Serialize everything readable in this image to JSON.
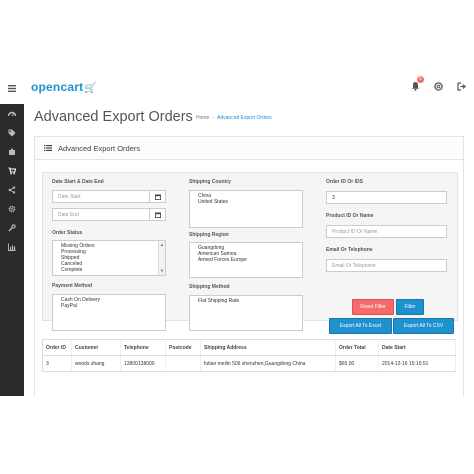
{
  "topbar": {
    "logo_text": "opencart",
    "logo_cart": "🛒",
    "alert_count": "6"
  },
  "page": {
    "title": "Advanced Export Orders",
    "breadcrumbs": [
      "Home",
      "Advanced Export Orders"
    ],
    "panel_title": "Advanced Export Orders"
  },
  "filters": {
    "date_label": "Date Start & Date End",
    "date_start_placeholder": "Date Start",
    "date_end_placeholder": "Date End",
    "order_status_label": "Order Status",
    "order_statuses": [
      "Missing Orders",
      "Processing",
      "Shipped",
      "Canceled",
      "Complete"
    ],
    "payment_method_label": "Payment Method",
    "payment_methods": [
      "Cash On Delivery",
      "PayPal"
    ],
    "shipping_country_label": "Shipping Country",
    "shipping_countries": [
      "China",
      "United States"
    ],
    "shipping_region_label": "Shipping Region",
    "shipping_regions": [
      "Guangdong",
      "American Samoa",
      "Armed Forces Europe"
    ],
    "shipping_method_label": "Shipping Method",
    "shipping_methods": [
      "Flat Shipping Rate"
    ],
    "order_id_label": "Order ID Or IDS",
    "order_id_value": "3",
    "product_id_label": "Product ID Or Name",
    "product_id_placeholder": "Product ID Or Name",
    "email_label": "Email Or Telephone",
    "email_placeholder": "Email Or Telephone",
    "reset_label": "Reset Filter",
    "filter_label": "Filter",
    "export_excel_label": "Export All To Excel",
    "export_csv_label": "Export All To CSV"
  },
  "table": {
    "headers": [
      "Order ID",
      "Customer",
      "Telephone",
      "Postcode",
      "Shipping Address",
      "Order Total",
      "Date Start"
    ],
    "rows": [
      [
        "3",
        "woods zhang",
        "13800138000",
        "",
        "futian meilin 506 shenzhen,Guangdong China",
        "$65.00",
        "2014-12-16 15:16:51"
      ]
    ]
  },
  "colors": {
    "brand": "#1e91cf",
    "danger": "#f56b6b",
    "sidebar": "#2b2b2b"
  }
}
